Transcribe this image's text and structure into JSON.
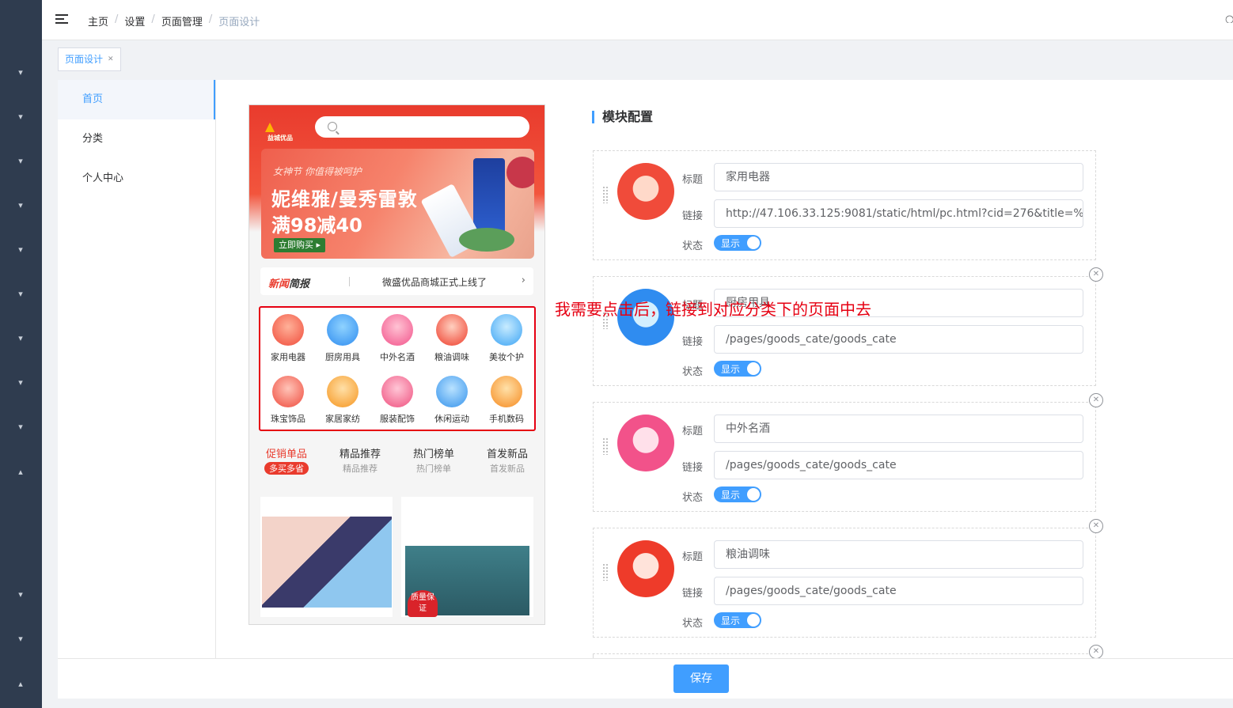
{
  "breadcrumb": [
    "主页",
    "设置",
    "页面管理",
    "页面设计"
  ],
  "tags": {
    "active": "页面设计"
  },
  "subnav": [
    "首页",
    "分类",
    "个人中心"
  ],
  "phone": {
    "logo": "益城优品",
    "banner": {
      "sub": "女神节 你值得被呵护",
      "line1": "妮维雅/曼秀雷敦",
      "line2": "满98减40",
      "buy": "立即购买 ▸"
    },
    "news": {
      "brand_a": "新闻",
      "brand_b": "简报",
      "msg": "微盛优品商城正式上线了",
      "arrow": "›"
    },
    "categories": [
      "家用电器",
      "厨房用具",
      "中外名酒",
      "粮油调味",
      "美妆个护",
      "珠宝饰品",
      "家居家纺",
      "服装配饰",
      "休闲运动",
      "手机数码"
    ],
    "promo": [
      {
        "title": "促销单品",
        "sub": "多买多省"
      },
      {
        "title": "精品推荐",
        "sub": "精品推荐"
      },
      {
        "title": "热门榜单",
        "sub": "热门榜单"
      },
      {
        "title": "首发新品",
        "sub": "首发新品"
      }
    ],
    "seal": "质量保证"
  },
  "config": {
    "title": "模块配置",
    "labels": {
      "title": "标题",
      "link": "链接",
      "status": "状态",
      "on": "显示"
    },
    "modules": [
      {
        "title": "家用电器",
        "link": "http://47.106.33.125:9081/static/html/pc.html?cid=276&title=%E7%9"
      },
      {
        "title": "厨房用具",
        "link": "/pages/goods_cate/goods_cate"
      },
      {
        "title": "中外名酒",
        "link": "/pages/goods_cate/goods_cate"
      },
      {
        "title": "粮油调味",
        "link": "/pages/goods_cate/goods_cate"
      }
    ]
  },
  "annotation": "我需要点击后，链接到对应分类下的页面中去",
  "footer": {
    "save": "保存"
  },
  "colors": {
    "primary": "#409eff",
    "accent": "#e93b2d",
    "rail": "#2f3c4f"
  }
}
